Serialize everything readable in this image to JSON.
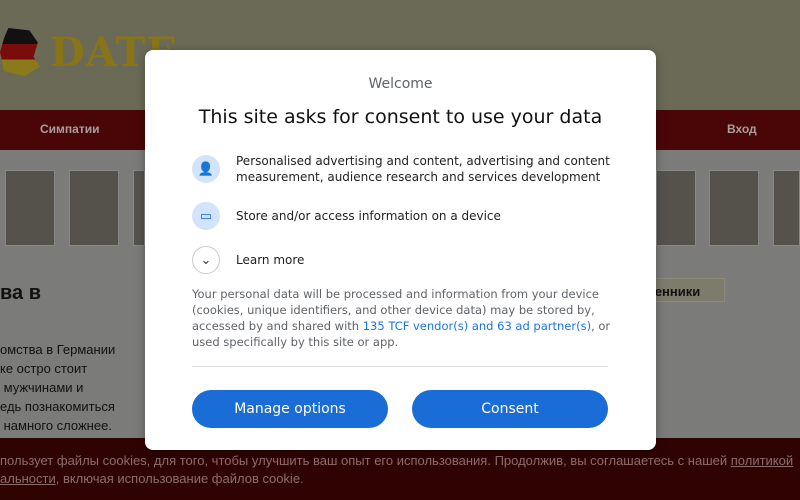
{
  "site": {
    "logo_text": "DATE",
    "nav": [
      "Симпатии",
      "Вход"
    ],
    "heading": "ва в",
    "tab": "венники",
    "paragraph": "омства в Германии\nке остро стоит\n мужчинами и\nедь познакомиться\n намного сложнее."
  },
  "cookie": {
    "text_before": "пользует файлы cookies, для того, чтобы улучшить ваш опыт его использования. Продолжив, вы соглашаетесь с нашей ",
    "link1": "политикой",
    "link2": "альности",
    "text_after": ", включая использование файлов cookie."
  },
  "consent": {
    "welcome": "Welcome",
    "title": "This site asks for consent to use your data",
    "purposes": [
      {
        "icon": "person-icon",
        "text": "Personalised advertising and content, advertising and content measurement, audience research and services development"
      },
      {
        "icon": "devices-icon",
        "text": "Store and/or access information on a device"
      }
    ],
    "learn_more": "Learn more",
    "body_before": "Your personal data will be processed and information from your device (cookies, unique identifiers, and other device data) may be stored by, accessed by and shared with ",
    "vendors_link": "135 TCF vendor(s) and 63 ad partner(s)",
    "body_after": ", or used specifically by this site or app.",
    "manage": "Manage options",
    "consent": "Consent",
    "accent": "#1a6dd6"
  }
}
